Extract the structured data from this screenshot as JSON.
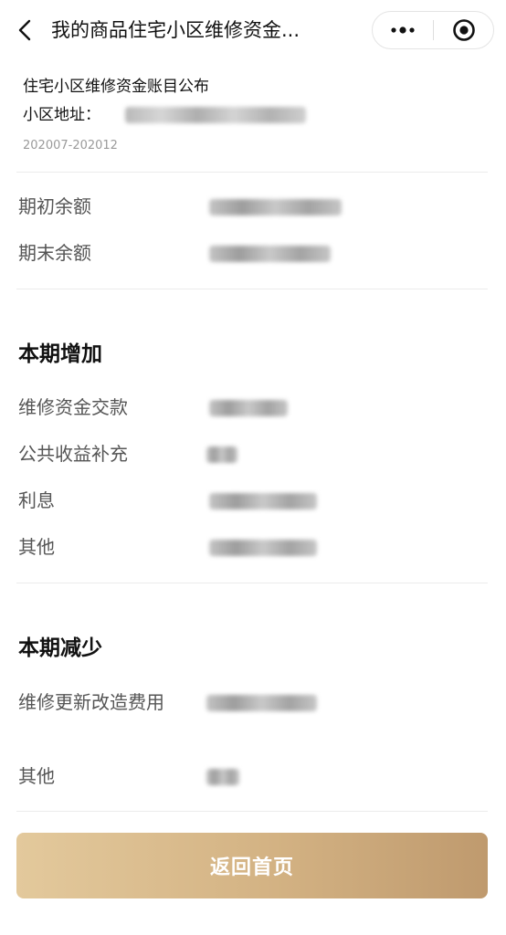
{
  "navbar": {
    "title": "我的商品住宅小区维修资金...",
    "back_icon": "chevron-left-icon",
    "more_icon": "more-dots-icon",
    "close_icon": "mini-program-close-icon"
  },
  "header": {
    "title": "住宅小区维修资金账目公布",
    "address_label": "小区地址：",
    "period": "202007-202012"
  },
  "balances": {
    "opening_label": "期初余额",
    "closing_label": "期末余额"
  },
  "increase": {
    "heading": "本期增加",
    "items": [
      {
        "label": "维修资金交款"
      },
      {
        "label": "公共收益补充"
      },
      {
        "label": "利息"
      },
      {
        "label": "其他"
      }
    ]
  },
  "decrease": {
    "heading": "本期减少",
    "items": [
      {
        "label": "维修更新改造费用"
      },
      {
        "label": "其他"
      }
    ]
  },
  "footer": {
    "home_button": "返回首页"
  },
  "colors": {
    "button_start": "#e3c99c",
    "button_end": "#bf9a6e",
    "label_text": "#555555",
    "period_text": "#9a9a9a"
  }
}
